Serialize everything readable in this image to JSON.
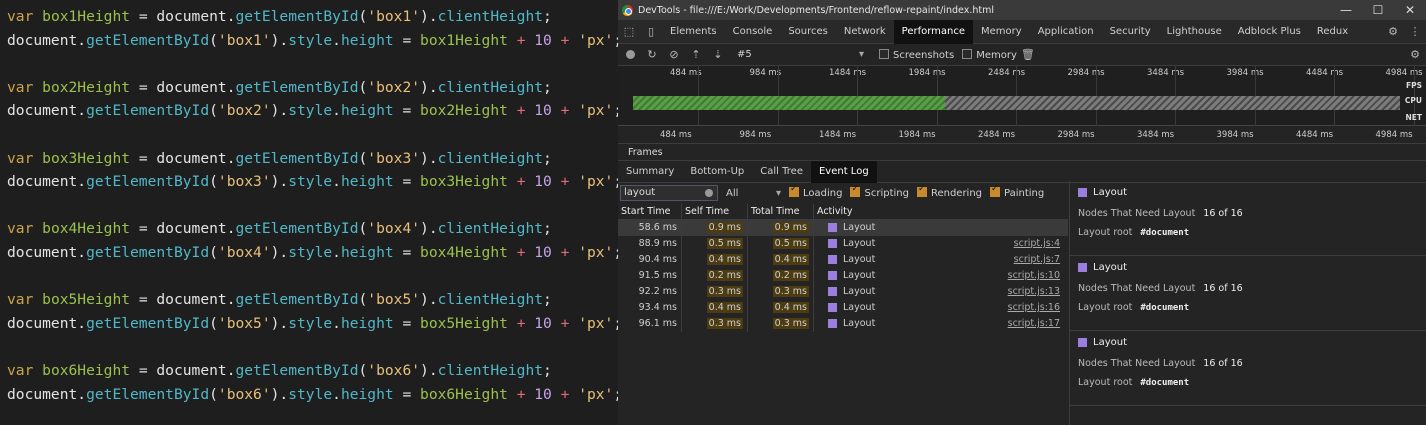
{
  "code_lines": [
    [
      [
        "var ",
        "kw"
      ],
      [
        "box1Height",
        "id"
      ],
      [
        " = ",
        "pl"
      ],
      [
        "document",
        "pl"
      ],
      [
        ".",
        "pl"
      ],
      [
        "getElementById",
        "fn"
      ],
      [
        "(",
        "pl"
      ],
      [
        "'box1'",
        "st"
      ],
      [
        ")",
        "pl"
      ],
      [
        ".",
        "pl"
      ],
      [
        "clientHeight",
        "fn"
      ],
      [
        ";",
        "pl"
      ]
    ],
    [
      [
        "document",
        "pl"
      ],
      [
        ".",
        "pl"
      ],
      [
        "getElementById",
        "fn"
      ],
      [
        "(",
        "pl"
      ],
      [
        "'box1'",
        "st"
      ],
      [
        ")",
        "pl"
      ],
      [
        ".",
        "pl"
      ],
      [
        "style",
        "fn"
      ],
      [
        ".",
        "pl"
      ],
      [
        "height",
        "fn"
      ],
      [
        " = ",
        "pl"
      ],
      [
        "box1Height",
        "id"
      ],
      [
        " + ",
        "op"
      ],
      [
        "10",
        "nu"
      ],
      [
        " + ",
        "op"
      ],
      [
        "'px'",
        "st"
      ],
      [
        ";",
        "pl"
      ]
    ],
    [],
    [
      [
        "var ",
        "kw"
      ],
      [
        "box2Height",
        "id"
      ],
      [
        " = ",
        "pl"
      ],
      [
        "document",
        "pl"
      ],
      [
        ".",
        "pl"
      ],
      [
        "getElementById",
        "fn"
      ],
      [
        "(",
        "pl"
      ],
      [
        "'box2'",
        "st"
      ],
      [
        ")",
        "pl"
      ],
      [
        ".",
        "pl"
      ],
      [
        "clientHeight",
        "fn"
      ],
      [
        ";",
        "pl"
      ]
    ],
    [
      [
        "document",
        "pl"
      ],
      [
        ".",
        "pl"
      ],
      [
        "getElementById",
        "fn"
      ],
      [
        "(",
        "pl"
      ],
      [
        "'box2'",
        "st"
      ],
      [
        ")",
        "pl"
      ],
      [
        ".",
        "pl"
      ],
      [
        "style",
        "fn"
      ],
      [
        ".",
        "pl"
      ],
      [
        "height",
        "fn"
      ],
      [
        " = ",
        "pl"
      ],
      [
        "box2Height",
        "id"
      ],
      [
        " + ",
        "op"
      ],
      [
        "10",
        "nu"
      ],
      [
        " + ",
        "op"
      ],
      [
        "'px'",
        "st"
      ],
      [
        ";",
        "pl"
      ]
    ],
    [],
    [
      [
        "var ",
        "kw"
      ],
      [
        "box3Height",
        "id"
      ],
      [
        " = ",
        "pl"
      ],
      [
        "document",
        "pl"
      ],
      [
        ".",
        "pl"
      ],
      [
        "getElementById",
        "fn"
      ],
      [
        "(",
        "pl"
      ],
      [
        "'box3'",
        "st"
      ],
      [
        ")",
        "pl"
      ],
      [
        ".",
        "pl"
      ],
      [
        "clientHeight",
        "fn"
      ],
      [
        ";",
        "pl"
      ]
    ],
    [
      [
        "document",
        "pl"
      ],
      [
        ".",
        "pl"
      ],
      [
        "getElementById",
        "fn"
      ],
      [
        "(",
        "pl"
      ],
      [
        "'box3'",
        "st"
      ],
      [
        ")",
        "pl"
      ],
      [
        ".",
        "pl"
      ],
      [
        "style",
        "fn"
      ],
      [
        ".",
        "pl"
      ],
      [
        "height",
        "fn"
      ],
      [
        " = ",
        "pl"
      ],
      [
        "box3Height",
        "id"
      ],
      [
        " + ",
        "op"
      ],
      [
        "10",
        "nu"
      ],
      [
        " + ",
        "op"
      ],
      [
        "'px'",
        "st"
      ],
      [
        ";",
        "pl"
      ]
    ],
    [],
    [
      [
        "var ",
        "kw"
      ],
      [
        "box4Height",
        "id"
      ],
      [
        " = ",
        "pl"
      ],
      [
        "document",
        "pl"
      ],
      [
        ".",
        "pl"
      ],
      [
        "getElementById",
        "fn"
      ],
      [
        "(",
        "pl"
      ],
      [
        "'box4'",
        "st"
      ],
      [
        ")",
        "pl"
      ],
      [
        ".",
        "pl"
      ],
      [
        "clientHeight",
        "fn"
      ],
      [
        ";",
        "pl"
      ]
    ],
    [
      [
        "document",
        "pl"
      ],
      [
        ".",
        "pl"
      ],
      [
        "getElementById",
        "fn"
      ],
      [
        "(",
        "pl"
      ],
      [
        "'box4'",
        "st"
      ],
      [
        ")",
        "pl"
      ],
      [
        ".",
        "pl"
      ],
      [
        "style",
        "fn"
      ],
      [
        ".",
        "pl"
      ],
      [
        "height",
        "fn"
      ],
      [
        " = ",
        "pl"
      ],
      [
        "box4Height",
        "id"
      ],
      [
        " + ",
        "op"
      ],
      [
        "10",
        "nu"
      ],
      [
        " + ",
        "op"
      ],
      [
        "'px'",
        "st"
      ],
      [
        ";",
        "pl"
      ]
    ],
    [],
    [
      [
        "var ",
        "kw"
      ],
      [
        "box5Height",
        "id"
      ],
      [
        " = ",
        "pl"
      ],
      [
        "document",
        "pl"
      ],
      [
        ".",
        "pl"
      ],
      [
        "getElementById",
        "fn"
      ],
      [
        "(",
        "pl"
      ],
      [
        "'box5'",
        "st"
      ],
      [
        ")",
        "pl"
      ],
      [
        ".",
        "pl"
      ],
      [
        "clientHeight",
        "fn"
      ],
      [
        ";",
        "pl"
      ]
    ],
    [
      [
        "document",
        "pl"
      ],
      [
        ".",
        "pl"
      ],
      [
        "getElementById",
        "fn"
      ],
      [
        "(",
        "pl"
      ],
      [
        "'box5'",
        "st"
      ],
      [
        ")",
        "pl"
      ],
      [
        ".",
        "pl"
      ],
      [
        "style",
        "fn"
      ],
      [
        ".",
        "pl"
      ],
      [
        "height",
        "fn"
      ],
      [
        " = ",
        "pl"
      ],
      [
        "box5Height",
        "id"
      ],
      [
        " + ",
        "op"
      ],
      [
        "10",
        "nu"
      ],
      [
        " + ",
        "op"
      ],
      [
        "'px'",
        "st"
      ],
      [
        ";",
        "pl"
      ]
    ],
    [],
    [
      [
        "var ",
        "kw"
      ],
      [
        "box6Height",
        "id"
      ],
      [
        " = ",
        "pl"
      ],
      [
        "document",
        "pl"
      ],
      [
        ".",
        "pl"
      ],
      [
        "getElementById",
        "fn"
      ],
      [
        "(",
        "pl"
      ],
      [
        "'box6'",
        "st"
      ],
      [
        ")",
        "pl"
      ],
      [
        ".",
        "pl"
      ],
      [
        "clientHeight",
        "fn"
      ],
      [
        ";",
        "pl"
      ]
    ],
    [
      [
        "document",
        "pl"
      ],
      [
        ".",
        "pl"
      ],
      [
        "getElementById",
        "fn"
      ],
      [
        "(",
        "pl"
      ],
      [
        "'box6'",
        "st"
      ],
      [
        ")",
        "pl"
      ],
      [
        ".",
        "pl"
      ],
      [
        "style",
        "fn"
      ],
      [
        ".",
        "pl"
      ],
      [
        "height",
        "fn"
      ],
      [
        " = ",
        "pl"
      ],
      [
        "box6Height",
        "id"
      ],
      [
        " + ",
        "op"
      ],
      [
        "10",
        "nu"
      ],
      [
        " + ",
        "op"
      ],
      [
        "'px'",
        "st"
      ],
      [
        ";",
        "pl"
      ]
    ]
  ],
  "devtools": {
    "title": "DevTools - file:///E:/Work/Developments/Frontend/reflow-repaint/index.html",
    "window_controls": [
      "—",
      "☐",
      "✕"
    ],
    "tabs": [
      "Elements",
      "Console",
      "Sources",
      "Network",
      "Performance",
      "Memory",
      "Application",
      "Security",
      "Lighthouse",
      "Adblock Plus",
      "Redux"
    ],
    "active_tab": "Performance",
    "toolbar": {
      "recording": "#5",
      "screenshots": "Screenshots",
      "memory": "Memory"
    },
    "ticks": [
      "484 ms",
      "984 ms",
      "1484 ms",
      "1984 ms",
      "2484 ms",
      "2984 ms",
      "3484 ms",
      "3984 ms",
      "4484 ms",
      "4984 ms"
    ],
    "overview_labels": {
      "fps": "FPS",
      "cpu": "CPU",
      "net": "NET"
    },
    "frames": "Frames",
    "subtabs": [
      "Summary",
      "Bottom-Up",
      "Call Tree",
      "Event Log"
    ],
    "active_subtab": "Event Log",
    "filter": {
      "value": "layout",
      "select": "All",
      "loading": "Loading",
      "scripting": "Scripting",
      "rendering": "Rendering",
      "painting": "Painting"
    },
    "columns": [
      "Start Time",
      "Self Time",
      "Total Time",
      "Activity"
    ],
    "rows": [
      {
        "start": "58.6 ms",
        "self": "0.9 ms",
        "total": "0.9 ms",
        "activity": "Layout",
        "source": ""
      },
      {
        "start": "88.9 ms",
        "self": "0.5 ms",
        "total": "0.5 ms",
        "activity": "Layout",
        "source": "script.js:4"
      },
      {
        "start": "90.4 ms",
        "self": "0.4 ms",
        "total": "0.4 ms",
        "activity": "Layout",
        "source": "script.js:7"
      },
      {
        "start": "91.5 ms",
        "self": "0.2 ms",
        "total": "0.2 ms",
        "activity": "Layout",
        "source": "script.js:10"
      },
      {
        "start": "92.2 ms",
        "self": "0.3 ms",
        "total": "0.3 ms",
        "activity": "Layout",
        "source": "script.js:13"
      },
      {
        "start": "93.4 ms",
        "self": "0.4 ms",
        "total": "0.4 ms",
        "activity": "Layout",
        "source": "script.js:16"
      },
      {
        "start": "96.1 ms",
        "self": "0.3 ms",
        "total": "0.3 ms",
        "activity": "Layout",
        "source": "script.js:17"
      }
    ],
    "cards": [
      {
        "title": "Layout",
        "k1": "Nodes That Need Layout",
        "v1": "16 of 16",
        "k2": "Layout root",
        "v2": "#document"
      },
      {
        "title": "Layout",
        "k1": "Nodes That Need Layout",
        "v1": "16 of 16",
        "k2": "Layout root",
        "v2": "#document"
      },
      {
        "title": "Layout",
        "k1": "Nodes That Need Layout",
        "v1": "16 of 16",
        "k2": "Layout root",
        "v2": "#document"
      }
    ],
    "colors": {
      "layout": "#9b7fe0",
      "checkbox": "#c88a2a"
    }
  }
}
